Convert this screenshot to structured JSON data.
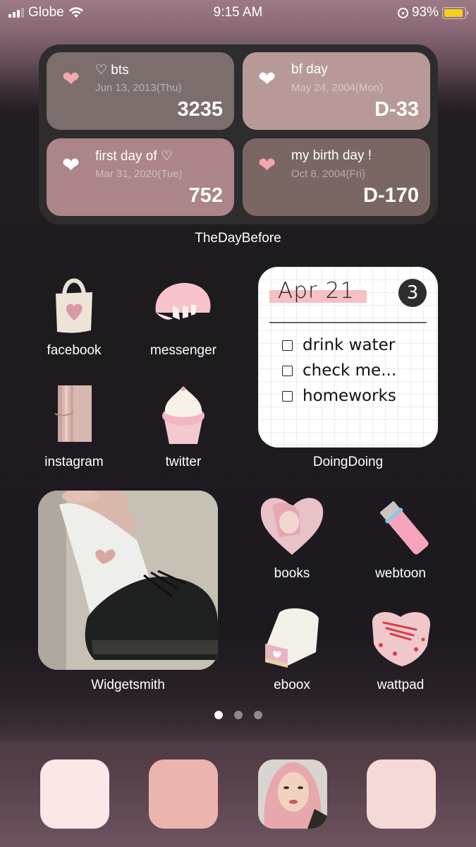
{
  "status_bar": {
    "carrier": "Globe",
    "time": "9:15 AM",
    "battery_percent": "93%",
    "battery_level": 0.93,
    "signal_bars": 3,
    "battery_color": "#f7cf1a"
  },
  "dday_widget": {
    "app_label": "TheDayBefore",
    "cards": [
      {
        "title": "♡ bts",
        "date": "Jun 13, 2013(Thu)",
        "count": "3235",
        "heart_color": "#f4a7ad",
        "bg": "#7c6e6d"
      },
      {
        "title": "bf day",
        "date": "May 24, 2004(Mon)",
        "count": "D-33",
        "heart_color": "#ffffff",
        "bg": "#b79a97"
      },
      {
        "title": "first day of ♡",
        "date": "Mar 31, 2020(Tue)",
        "count": "752",
        "heart_color": "#ffffff",
        "bg": "#ab8589"
      },
      {
        "title": "my birth day !",
        "date": "Oct 8, 2004(Fri)",
        "count": "D-170",
        "heart_color": "#f4a7ad",
        "bg": "#7a6763"
      }
    ]
  },
  "apps": {
    "facebook": "facebook",
    "messenger": "messenger",
    "instagram": "instagram",
    "twitter": "twitter",
    "books": "books",
    "webtoon": "webtoon",
    "eboox": "eboox",
    "wattpad": "wattpad"
  },
  "todo_widget": {
    "app_label": "DoingDoing",
    "date": "Apr 21",
    "count": "3",
    "items": [
      "drink water",
      "check me...",
      "homeworks"
    ]
  },
  "photo_widget": {
    "app_label": "Widgetsmith"
  },
  "page_indicator": {
    "total": 3,
    "current": 1
  },
  "dock": {
    "colors": [
      "#fbe6e8",
      "#ecb4ae",
      "photo",
      "#f5d9d6"
    ]
  }
}
